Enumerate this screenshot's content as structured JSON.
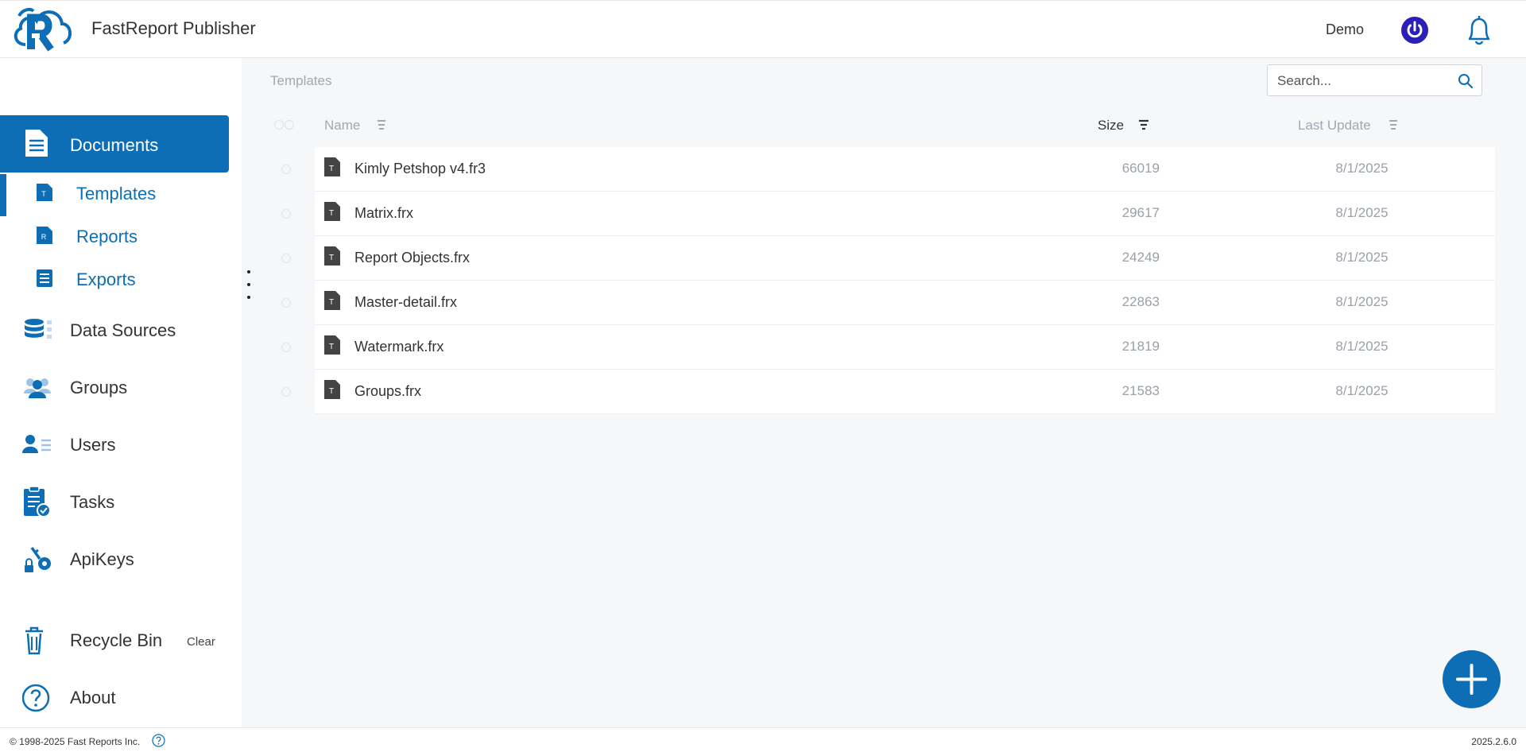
{
  "header": {
    "app_title": "FastReport Publisher",
    "user_name": "Demo"
  },
  "sidebar": {
    "items": [
      {
        "label": "Documents",
        "icon": "document-icon",
        "active": true
      },
      {
        "label": "Data Sources",
        "icon": "database-icon"
      },
      {
        "label": "Groups",
        "icon": "groups-icon"
      },
      {
        "label": "Users",
        "icon": "users-icon"
      },
      {
        "label": "Tasks",
        "icon": "tasks-icon"
      },
      {
        "label": "ApiKeys",
        "icon": "api-key-icon"
      },
      {
        "label": "Recycle Bin",
        "icon": "trash-icon"
      },
      {
        "label": "About",
        "icon": "question-icon"
      }
    ],
    "sub_items": [
      {
        "label": "Templates",
        "icon_letter": "T",
        "current": true
      },
      {
        "label": "Reports",
        "icon_letter": "R"
      },
      {
        "label": "Exports",
        "icon": "list-icon"
      }
    ],
    "recycle_clear_label": "Clear"
  },
  "main": {
    "breadcrumb": "Templates",
    "search": {
      "placeholder": "Search..."
    },
    "columns": {
      "name": "Name",
      "size": "Size",
      "last_update": "Last Update"
    },
    "file_icon_letter": "T",
    "rows": [
      {
        "name": "Kimly Petshop v4.fr3",
        "size": "66019",
        "date": "8/1/2025"
      },
      {
        "name": "Matrix.frx",
        "size": "29617",
        "date": "8/1/2025"
      },
      {
        "name": "Report Objects.frx",
        "size": "24249",
        "date": "8/1/2025"
      },
      {
        "name": "Master-detail.frx",
        "size": "22863",
        "date": "8/1/2025"
      },
      {
        "name": "Watermark.frx",
        "size": "21819",
        "date": "8/1/2025"
      },
      {
        "name": "Groups.frx",
        "size": "21583",
        "date": "8/1/2025"
      }
    ]
  },
  "footer": {
    "copyright": "© 1998-2025 Fast Reports Inc.",
    "version": "2025.2.6.0"
  },
  "colors": {
    "accent": "#0d6eb6",
    "power": "#2a1fb8",
    "muted_text": "#a2a8b0"
  }
}
